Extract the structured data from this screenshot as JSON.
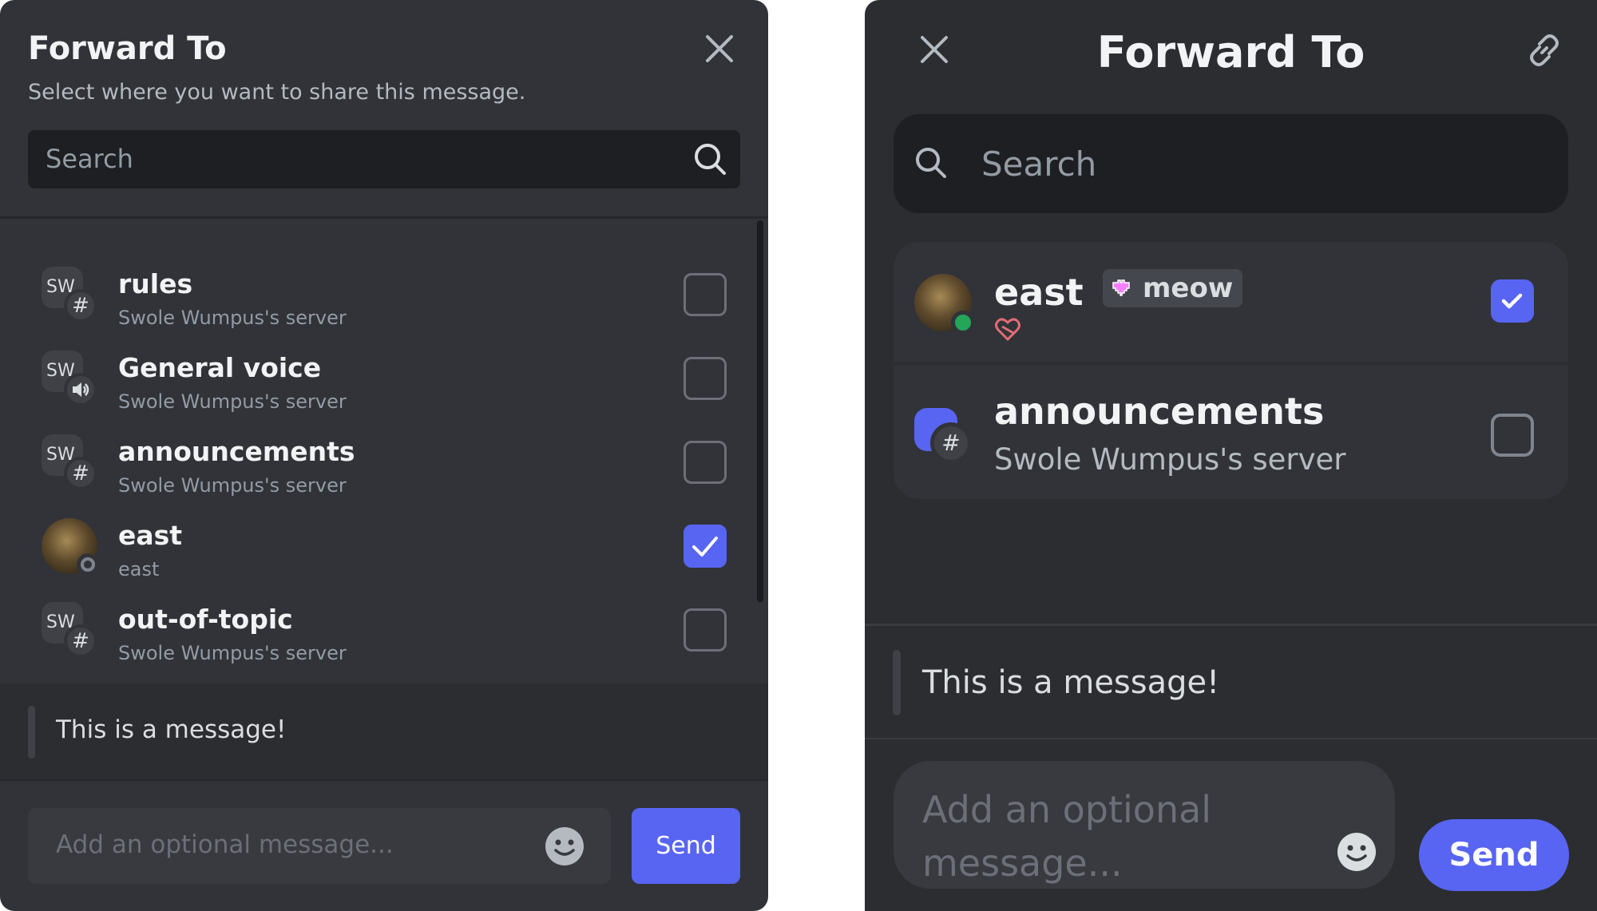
{
  "desktop": {
    "title": "Forward To",
    "subtitle": "Select where you want to share this message.",
    "search_placeholder": "Search",
    "items": [
      {
        "guild_abbr": "SW",
        "badge": "#",
        "name": "rules",
        "sub": "Swole Wumpus's server",
        "checked": false
      },
      {
        "guild_abbr": "SW",
        "badge": "speaker",
        "name": "General voice",
        "sub": "Swole Wumpus's server",
        "checked": false
      },
      {
        "guild_abbr": "SW",
        "badge": "#",
        "name": "announcements",
        "sub": "Swole Wumpus's server",
        "checked": false
      },
      {
        "guild_abbr": "",
        "badge": "avatar",
        "name": "east",
        "sub": "east",
        "checked": true
      },
      {
        "guild_abbr": "SW",
        "badge": "#",
        "name": "out-of-topic",
        "sub": "Swole Wumpus's server",
        "checked": false
      }
    ],
    "message": "This is a message!",
    "input_placeholder": "Add an optional message...",
    "send_label": "Send"
  },
  "mobile": {
    "title": "Forward To",
    "search_placeholder": "Search",
    "items": [
      {
        "name": "east",
        "tag": "meow",
        "checked": true
      },
      {
        "name": "announcements",
        "sub": "Swole Wumpus's server",
        "checked": false
      }
    ],
    "message": "This is a message!",
    "input_placeholder": "Add an optional message...",
    "send_label": "Send"
  },
  "colors": {
    "accent": "#5865f2",
    "background": "#313338",
    "online": "#23a55a"
  }
}
